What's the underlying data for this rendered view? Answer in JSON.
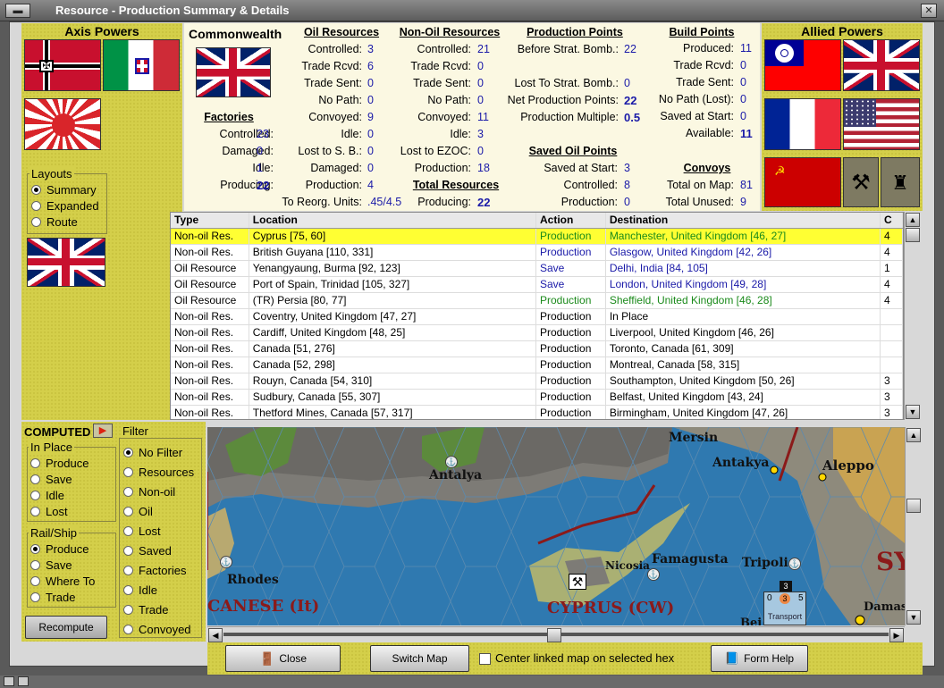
{
  "window": {
    "title": "Resource - Production Summary & Details"
  },
  "axis": {
    "title": "Axis Powers"
  },
  "allied": {
    "title": "Allied Powers"
  },
  "nation": {
    "name": "Commonwealth"
  },
  "layouts": {
    "title": "Layouts",
    "options": [
      "Summary",
      "Expanded",
      "Route"
    ],
    "selected": 0
  },
  "factories": {
    "title": "Factories",
    "rows": [
      {
        "label": "Controlled:",
        "value": "23"
      },
      {
        "label": "Damaged:",
        "value": "0"
      },
      {
        "label": "Idle:",
        "value": "1"
      },
      {
        "label": "Producing:",
        "value": "22"
      }
    ]
  },
  "oil": {
    "title": "Oil Resources",
    "rows": [
      {
        "label": "Controlled:",
        "value": "3"
      },
      {
        "label": "Trade Rcvd:",
        "value": "6"
      },
      {
        "label": "Trade Sent:",
        "value": "0"
      },
      {
        "label": "No Path:",
        "value": "0"
      },
      {
        "label": "Convoyed:",
        "value": "9"
      },
      {
        "label": "Idle:",
        "value": "0"
      },
      {
        "label": "Lost to S. B.:",
        "value": "0"
      },
      {
        "label": "Damaged:",
        "value": "0"
      },
      {
        "label": "Production:",
        "value": "4"
      },
      {
        "label": "To Reorg. Units:",
        "value": ".45/4.5"
      }
    ]
  },
  "nonoil": {
    "title": "Non-Oil Resources",
    "rows": [
      {
        "label": "Controlled:",
        "value": "21"
      },
      {
        "label": "Trade Rcvd:",
        "value": "0"
      },
      {
        "label": "Trade Sent:",
        "value": "0"
      },
      {
        "label": "No Path:",
        "value": "0"
      },
      {
        "label": "Convoyed:",
        "value": "11"
      },
      {
        "label": "Idle:",
        "value": "3"
      },
      {
        "label": "Lost to EZOC:",
        "value": "0"
      },
      {
        "label": "Production:",
        "value": "18"
      }
    ]
  },
  "total": {
    "title": "Total Resources",
    "label": "Producing:",
    "value": "22"
  },
  "pp": {
    "title": "Production Points",
    "rows": [
      {
        "label": "Before Strat. Bomb.:",
        "value": "22"
      },
      {
        "label": "Lost To Strat. Bomb.:",
        "value": "0"
      },
      {
        "label": "Net Production Points:",
        "value": "22"
      },
      {
        "label": "Production Multiple:",
        "value": "0.5"
      }
    ]
  },
  "savedoil": {
    "title": "Saved Oil Points",
    "rows": [
      {
        "label": "Saved at Start:",
        "value": "3"
      },
      {
        "label": "Controlled:",
        "value": "8"
      },
      {
        "label": "Production:",
        "value": "0"
      }
    ]
  },
  "bp": {
    "title": "Build Points",
    "rows": [
      {
        "label": "Produced:",
        "value": "11"
      },
      {
        "label": "Trade Rcvd:",
        "value": "0"
      },
      {
        "label": "Trade Sent:",
        "value": "0"
      },
      {
        "label": "No Path (Lost):",
        "value": "0"
      },
      {
        "label": "Saved at Start:",
        "value": "0"
      },
      {
        "label": "Available:",
        "value": "11"
      }
    ]
  },
  "convoys": {
    "title": "Convoys",
    "rows": [
      {
        "label": "Total on Map:",
        "value": "81"
      },
      {
        "label": "Total Unused:",
        "value": "9"
      }
    ]
  },
  "table": {
    "headers": [
      "Type",
      "Location",
      "Action",
      "Destination",
      "C"
    ],
    "rows": [
      [
        "Non-oil Res.",
        "Cyprus [75, 60]",
        "Production",
        "Manchester, United Kingdom [46, 27]",
        "4"
      ],
      [
        "Non-oil Res.",
        "British Guyana [110, 331]",
        "Production",
        "Glasgow, United Kingdom [42, 26]",
        "4"
      ],
      [
        "Oil Resource",
        "Yenangyaung, Burma [92, 123]",
        "Save",
        "Delhi, India [84, 105]",
        "1"
      ],
      [
        "Oil Resource",
        "Port of Spain, Trinidad [105, 327]",
        "Save",
        "London, United Kingdom [49, 28]",
        "4"
      ],
      [
        "Oil Resource",
        "(TR) Persia [80, 77]",
        "Production",
        "Sheffield, United Kingdom [46, 28]",
        "4"
      ],
      [
        "Non-oil Res.",
        "Coventry, United Kingdom [47, 27]",
        "Production",
        "In Place",
        ""
      ],
      [
        "Non-oil Res.",
        "Cardiff, United Kingdom [48, 25]",
        "Production",
        "Liverpool, United Kingdom [46, 26]",
        ""
      ],
      [
        "Non-oil Res.",
        "Canada [51, 276]",
        "Production",
        "Toronto, Canada [61, 309]",
        ""
      ],
      [
        "Non-oil Res.",
        "Canada [52, 298]",
        "Production",
        "Montreal, Canada [58, 315]",
        ""
      ],
      [
        "Non-oil Res.",
        "Rouyn, Canada [54, 310]",
        "Production",
        "Southampton, United Kingdom [50, 26]",
        "3"
      ],
      [
        "Non-oil Res.",
        "Sudbury, Canada [55, 307]",
        "Production",
        "Belfast, United Kingdom [43, 24]",
        "3"
      ],
      [
        "Non-oil Res.",
        "Thetford Mines, Canada [57, 317]",
        "Production",
        "Birmingham, United Kingdom [47, 26]",
        "3"
      ]
    ],
    "row_colors": [
      "green",
      "blue",
      "blue",
      "blue",
      "green",
      "",
      "",
      "",
      "",
      "",
      "",
      ""
    ],
    "selected_row": 0
  },
  "computed": {
    "label": "COMPUTED"
  },
  "inplace": {
    "title": "In Place",
    "options": [
      "Produce",
      "Save",
      "Idle",
      "Lost"
    ],
    "selected": -1
  },
  "railship": {
    "title": "Rail/Ship",
    "options": [
      "Produce",
      "Save",
      "Where To",
      "Trade"
    ],
    "selected": 0
  },
  "filter": {
    "title": "Filter",
    "options": [
      "No Filter",
      "Resources",
      "Non-oil",
      "Oil",
      "Lost",
      "Saved",
      "Factories",
      "Idle",
      "Trade",
      "Convoyed"
    ],
    "selected": 0
  },
  "recompute": {
    "label": "Recompute"
  },
  "map": {
    "labels": {
      "mersin": "Mersin",
      "antakya": "Antakya",
      "aleppo": "Aleppo",
      "antalya": "Antalya",
      "nicosia": "Nicosia",
      "famagusta": "Famagusta",
      "tripoli": "Tripoli",
      "rhodes": "Rhodes",
      "dodecanese": "CANESE (It)",
      "cyprus": "CYPRUS (CW)",
      "syria": "SY",
      "damascus": "Damas",
      "beirut": "Bei",
      "transport": "Transport",
      "unit_top": "3",
      "unit_left": "0",
      "unit_mid": "3",
      "unit_right": "5"
    }
  },
  "buttons": {
    "close": "Close",
    "switch_map": "Switch Map",
    "center_linked": "Center linked map on selected hex",
    "center_checked": false,
    "form_help": "Form Help"
  }
}
